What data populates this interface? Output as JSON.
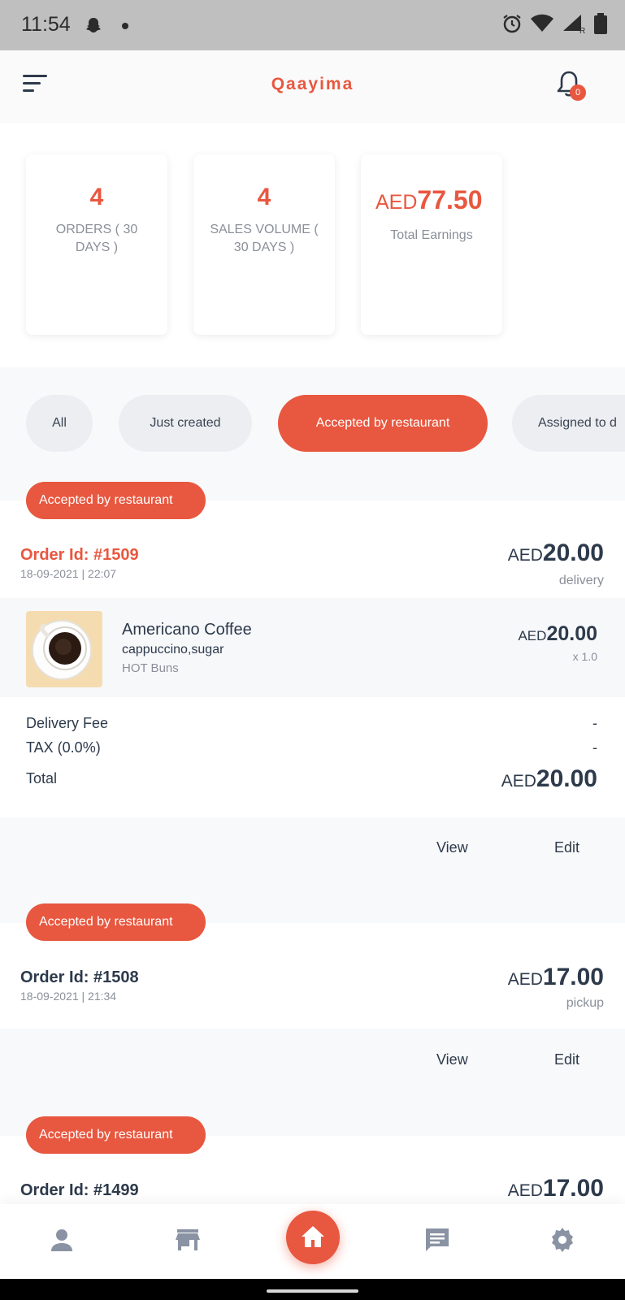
{
  "status_bar": {
    "time": "11:54"
  },
  "header": {
    "title": "Qaayima",
    "notification_count": "0"
  },
  "stats": {
    "orders_value": "4",
    "orders_label": "ORDERS ( 30 DAYS )",
    "sales_value": "4",
    "sales_label": "SALES VOLUME ( 30 DAYS )",
    "earnings_currency": "AED",
    "earnings_amount": "77.50",
    "earnings_label": "Total Earnings"
  },
  "filters": [
    "All",
    "Just created",
    "Accepted by restaurant",
    "Assigned to d"
  ],
  "active_filter": "Accepted by restaurant",
  "orders": [
    {
      "status": "Accepted by restaurant",
      "id": "Order Id: #1509",
      "date": "18-09-2021 | 22:07",
      "currency": "AED",
      "total": "20.00",
      "type": "delivery",
      "item": {
        "name": "Americano Coffee",
        "addons": "cappuccino,sugar",
        "vendor": "HOT Buns",
        "currency": "AED",
        "price": "20.00",
        "qty": "x 1.0"
      },
      "summary": {
        "delivery_fee_label": "Delivery Fee",
        "delivery_fee": "-",
        "tax_label": "TAX (0.0%)",
        "tax": "-",
        "total_label": "Total",
        "currency": "AED",
        "total": "20.00"
      },
      "view_label": "View",
      "edit_label": "Edit"
    },
    {
      "status": "Accepted by restaurant",
      "id": "Order Id: #1508",
      "date": "18-09-2021 | 21:34",
      "currency": "AED",
      "total": "17.00",
      "type": "pickup",
      "view_label": "View",
      "edit_label": "Edit"
    },
    {
      "status": "Accepted by restaurant",
      "id": "Order Id: #1499",
      "currency": "AED",
      "total": "17.00"
    }
  ],
  "colors": {
    "accent": "#e8573f",
    "text": "#2d3a4b",
    "muted": "#8a8f99"
  },
  "bottom_nav_icons": [
    "person-icon",
    "store-icon",
    "home-icon",
    "chat-icon",
    "settings-icon"
  ]
}
